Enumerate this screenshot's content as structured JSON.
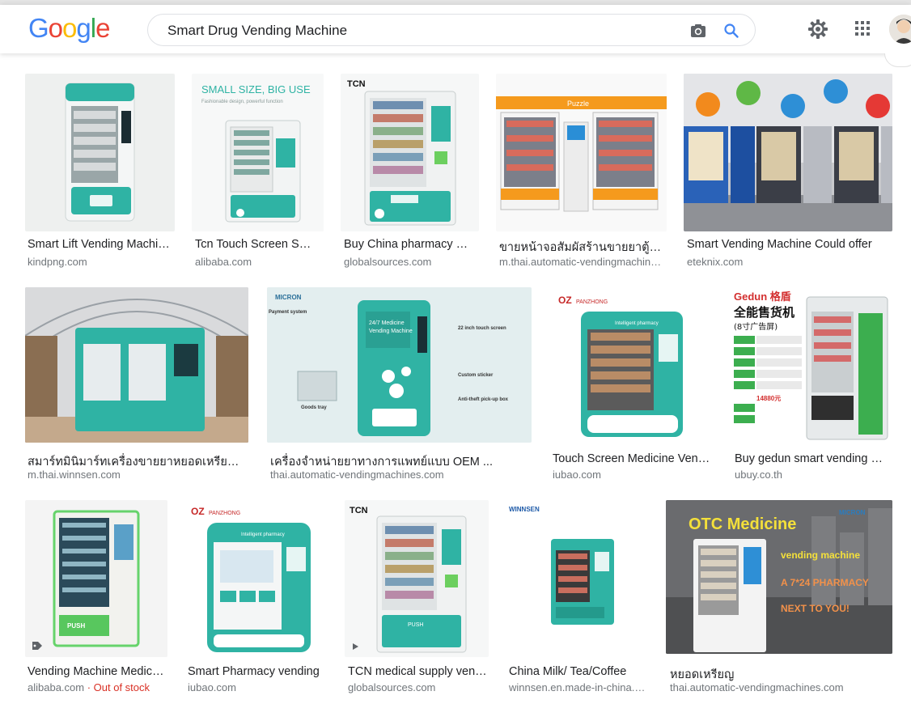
{
  "header": {
    "logo_letters": [
      {
        "ch": "G",
        "color": "#4285F4"
      },
      {
        "ch": "o",
        "color": "#EA4335"
      },
      {
        "ch": "o",
        "color": "#FBBC05"
      },
      {
        "ch": "g",
        "color": "#4285F4"
      },
      {
        "ch": "l",
        "color": "#34A853"
      },
      {
        "ch": "e",
        "color": "#EA4335"
      }
    ],
    "search_value": "Smart Drug Vending Machine",
    "icons": [
      "camera-icon",
      "search-icon",
      "gear-icon",
      "apps-grid-icon",
      "avatar"
    ]
  },
  "colors": {
    "accent_blue": "#4285F4",
    "title_text": "#202124",
    "source_text": "#70757a",
    "out_of_stock": "#d93025",
    "teal_machine": "#25b3a3"
  },
  "results": [
    {
      "title": "Smart Lift Vending Machine Drugs",
      "source": "kindpng.com"
    },
    {
      "title": "Tcn Touch Screen Smart",
      "source": "alibaba.com"
    },
    {
      "title": "Buy China pharmacy vending",
      "source": "globalsources.com"
    },
    {
      "title": "ขายหน้าจอสัมผัสร้านขายยาตู้จำหน่าย",
      "source": "m.thai.automatic-vendingmachines.com"
    },
    {
      "title": "Smart Vending Machine Could offer",
      "source": "eteknix.com"
    },
    {
      "title": "สมาร์ทมินิมาร์ทเครื่องขายยาหยอดเหรียญอัตโนมัติ",
      "source": "m.thai.winnsen.com"
    },
    {
      "title": "เครื่องจำหน่ายยาทางการแพทย์แบบ OEM ...",
      "source": "thai.automatic-vendingmachines.com"
    },
    {
      "title": "Touch Screen Medicine Vending",
      "source": "iubao.com"
    },
    {
      "title": "Buy gedun smart vending machine",
      "source": "ubuy.co.th"
    },
    {
      "title": "Vending Machine Medicine",
      "source": "alibaba.com",
      "source_extra": " · Out of stock"
    },
    {
      "title": "Smart Pharmacy vending",
      "source": "iubao.com"
    },
    {
      "title": "TCN medical supply vending",
      "source": "globalsources.com"
    },
    {
      "title": "China Milk/ Tea/Coffee",
      "source": "winnsen.en.made-in-china.com"
    },
    {
      "title": "หยอดเหรียญ",
      "source": "thai.automatic-vendingmachines.com"
    }
  ],
  "thumb_text": {
    "t2_headline": "SMALL SIZE, BIG USE",
    "t2_sub": "Fashionable design, powerful function",
    "t3_brand": "TCN",
    "t4_brand": "Puzzle",
    "t6_brand": "MICRON",
    "t6_line1": "24/7 Medicine",
    "t6_line2": "Vending Machine",
    "t6_payment": "Payment system",
    "t6_touch": "22 inch touch screen",
    "t6_sticker": "Custom sticker",
    "t6_anti": "Anti-theft pick-up box",
    "t6_tray": "Goods tray",
    "t7_brand": "PANZHONG",
    "t7_pharmacy": "Intelligent pharmacy",
    "t8_brand": "Gedun 格盾",
    "t8_headline": "全能售货机",
    "t8_sub": "(8寸广告屏)",
    "t8_price": "14880元",
    "t9_push": "PUSH",
    "t10_brand": "PANZHONG",
    "t10_pharmacy": "Intelligent pharmacy",
    "t11_brand": "TCN",
    "t11_push": "PUSH",
    "t12_brand": "WINNSEN",
    "t13_title": "OTC Medicine",
    "t13_vm": "vending machine",
    "t13_pharm": "A 7*24 PHARMACY",
    "t13_next": "NEXT TO YOU!",
    "t13_brand": "MICRON"
  }
}
